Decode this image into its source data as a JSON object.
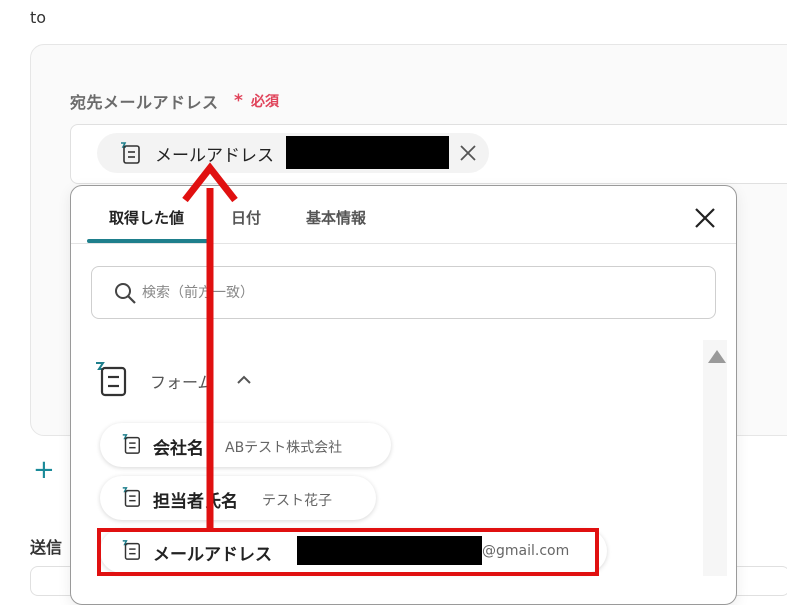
{
  "to_label": "to",
  "field": {
    "label": "宛先メールアドレス",
    "required_mark": "*",
    "required_text": "必須"
  },
  "selected_chip": {
    "label": "メールアドレス",
    "icon": "form-icon",
    "remove_icon": "close-icon"
  },
  "add_action": {
    "icon": "plus-icon",
    "text": "+"
  },
  "sender_label": "送信",
  "picker": {
    "tabs": [
      {
        "label": "取得した値",
        "active": true
      },
      {
        "label": "日付",
        "active": false
      },
      {
        "label": "基本情報",
        "active": false
      }
    ],
    "close_icon": "close-icon",
    "search": {
      "placeholder": "検索（前方一致）",
      "value": "",
      "icon": "search-icon"
    },
    "group": {
      "label": "フォーム",
      "icon": "form-icon",
      "chevron_icon": "chevron-up-icon",
      "expanded": true,
      "items": [
        {
          "label": "会社名",
          "value": "ABテスト株式会社"
        },
        {
          "label": "担当者氏名",
          "value": "テスト花子"
        },
        {
          "label": "メールアドレス",
          "value": "@gmail.com"
        }
      ]
    }
  },
  "colors": {
    "accent": "#1e7f8c",
    "required": "#e0435a",
    "annotation": "#e01010"
  }
}
